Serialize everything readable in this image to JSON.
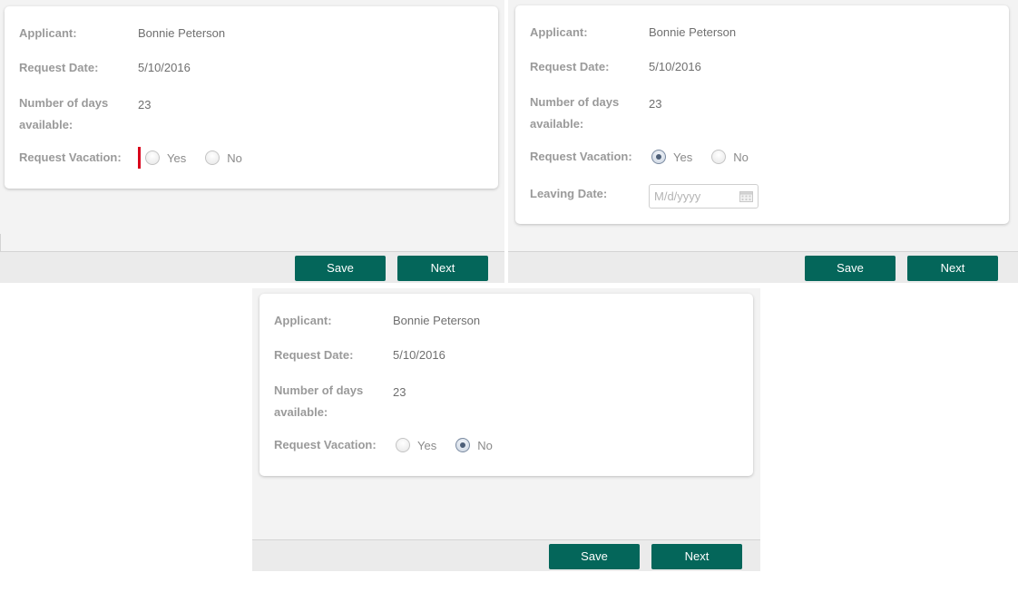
{
  "labels": {
    "applicant": "Applicant:",
    "request_date": "Request Date:",
    "days_line1": "Number of days",
    "days_line2": "available:",
    "request_vacation": "Request Vacation:",
    "leaving_date": "Leaving Date:"
  },
  "values": {
    "applicant": "Bonnie Peterson",
    "request_date": "5/10/2016",
    "days_available": "23"
  },
  "options": {
    "yes": "Yes",
    "no": "No"
  },
  "leaving_date_placeholder": "M/d/yyyy",
  "buttons": {
    "save": "Save",
    "next": "Next"
  },
  "panels": [
    {
      "state": "none selected (validation error)"
    },
    {
      "state": "Yes selected"
    },
    {
      "state": "No selected"
    }
  ],
  "colors": {
    "button": "#04665a",
    "error": "#d9001b"
  }
}
